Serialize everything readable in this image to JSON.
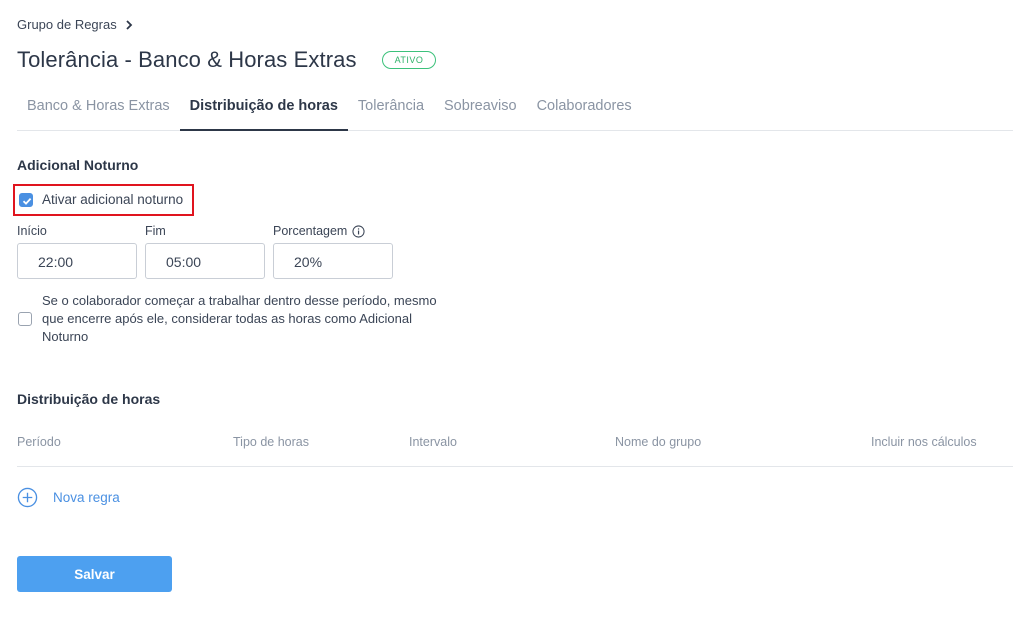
{
  "breadcrumb": {
    "label": "Grupo de Regras"
  },
  "header": {
    "title": "Tolerância - Banco & Horas Extras",
    "status": "ATIVO"
  },
  "tabs": [
    {
      "label": "Banco & Horas Extras",
      "active": false
    },
    {
      "label": "Distribuição de horas",
      "active": true
    },
    {
      "label": "Tolerância",
      "active": false
    },
    {
      "label": "Sobreaviso",
      "active": false
    },
    {
      "label": "Colaboradores",
      "active": false
    }
  ],
  "night": {
    "title": "Adicional Noturno",
    "enable_label": "Ativar adicional noturno",
    "enable_checked": true,
    "start_label": "Início",
    "start_value": "22:00",
    "end_label": "Fim",
    "end_value": "05:00",
    "percent_label": "Porcentagem",
    "percent_value": "20%",
    "whole_shift_label": "Se o colaborador começar a trabalhar dentro desse período, mesmo que encerre após ele, considerar todas as horas como Adicional Noturno",
    "whole_shift_checked": false
  },
  "distribution": {
    "title": "Distribuição de horas",
    "columns": [
      "Período",
      "Tipo de horas",
      "Intervalo",
      "Nome do grupo",
      "Incluir nos cálculos"
    ],
    "new_rule_label": "Nova regra"
  },
  "actions": {
    "save_label": "Salvar"
  },
  "colors": {
    "accent": "#4a90e2",
    "save_button": "#4da0f0",
    "status": "#2fb26a",
    "highlight": "#e0141e"
  }
}
